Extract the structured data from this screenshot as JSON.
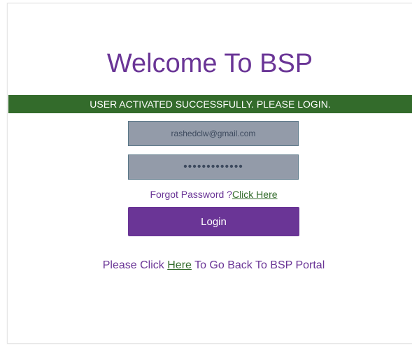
{
  "header": {
    "title": "Welcome To BSP"
  },
  "banner": {
    "message": "USER ACTIVATED SUCCESSFULLY. PLEASE LOGIN."
  },
  "form": {
    "email_value": "rashedclw@gmail.com",
    "password_value": "•••••••••••••",
    "forgot_prefix": "Forgot Password ?",
    "forgot_link": "Click Here",
    "login_label": "Login"
  },
  "footer": {
    "back_prefix": "Please Click ",
    "back_link": "Here",
    "back_suffix": " To Go Back To BSP Portal"
  },
  "colors": {
    "accent_purple": "#6a3596",
    "banner_green": "#336b2b",
    "input_bg": "#939ba9"
  }
}
